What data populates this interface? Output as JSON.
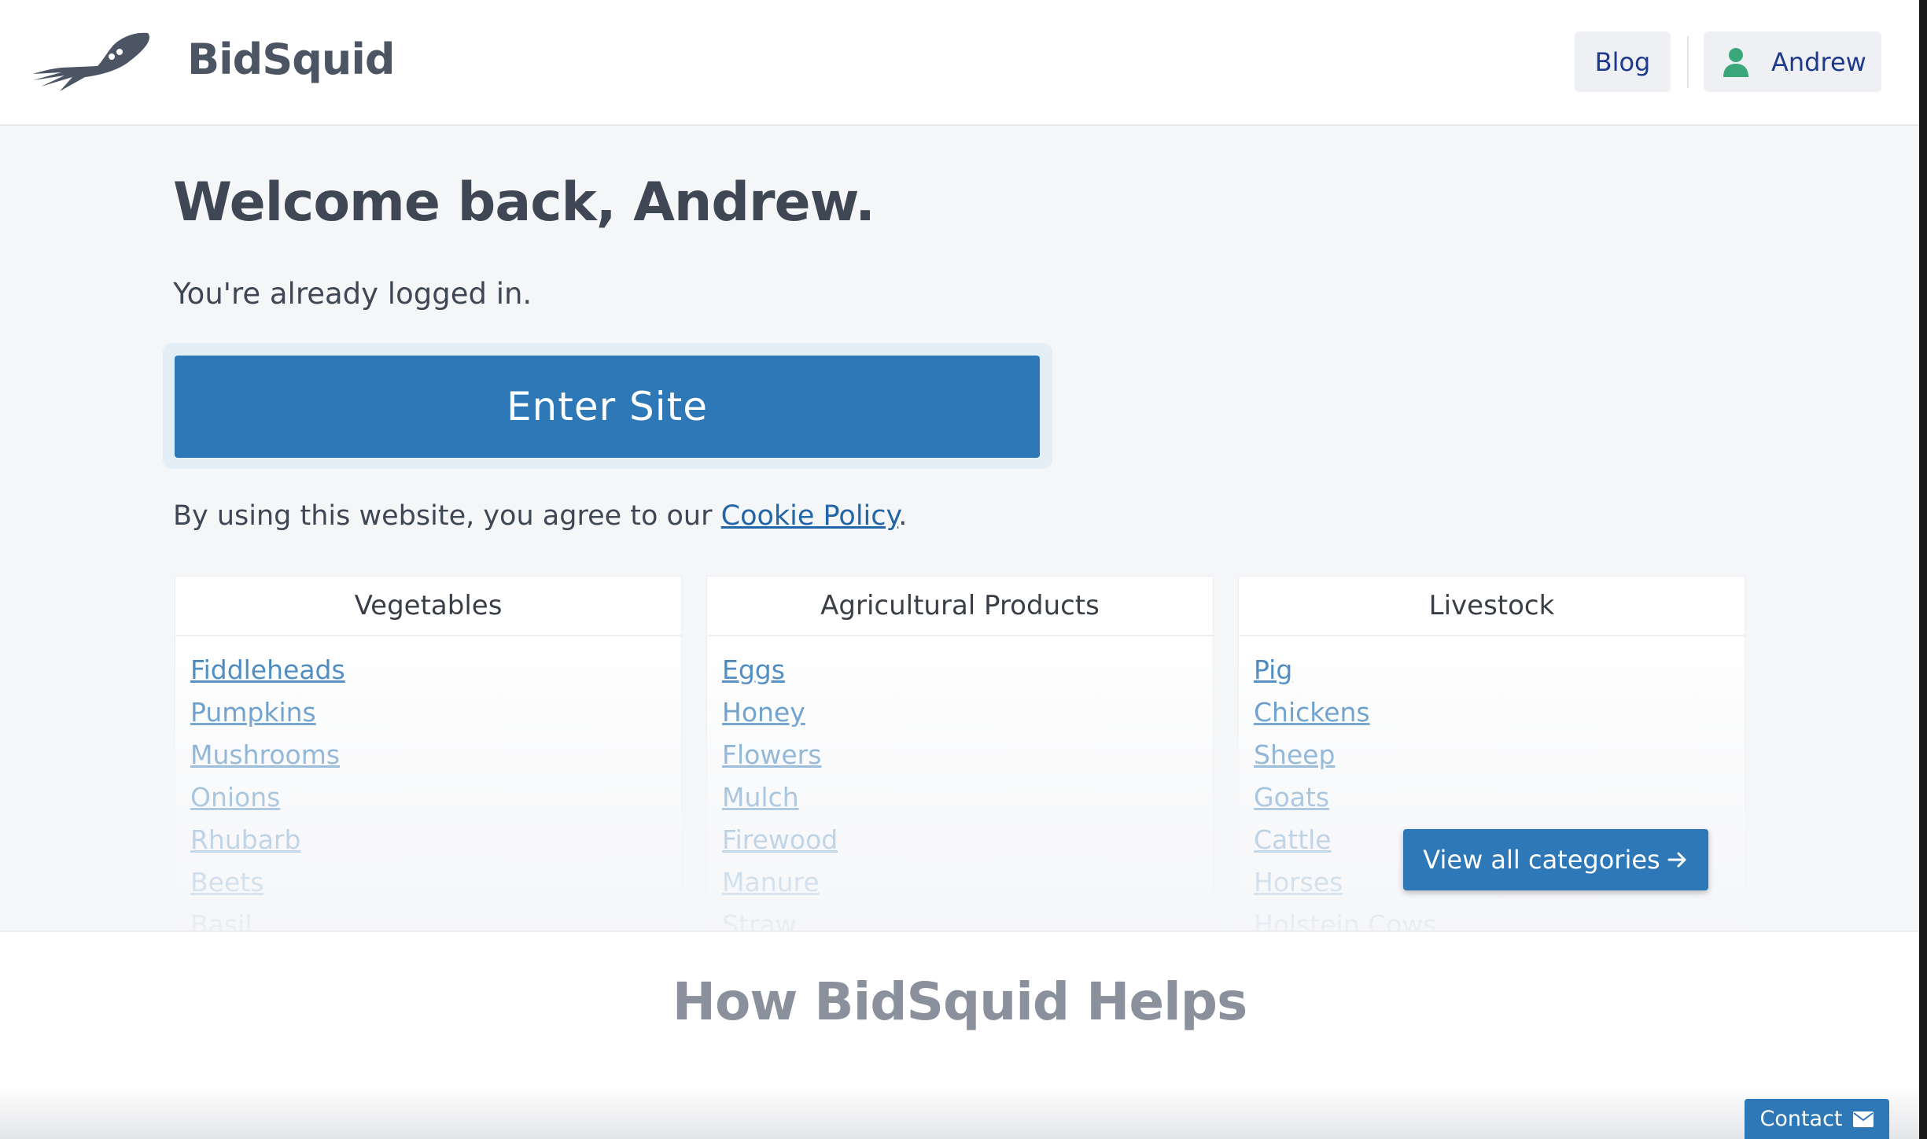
{
  "header": {
    "brand": "BidSquid",
    "nav": {
      "blog": "Blog",
      "user": "Andrew"
    }
  },
  "main": {
    "welcome": "Welcome back, Andrew.",
    "logged_in": "You're already logged in.",
    "enter_button": "Enter Site",
    "agree_text": "By using this website, you agree to our ",
    "cookie_link": "Cookie Policy",
    "agree_end": "."
  },
  "categories": [
    {
      "title": "Vegetables",
      "items": [
        "Fiddleheads",
        "Pumpkins",
        "Mushrooms",
        "Onions",
        "Rhubarb",
        "Beets",
        "Basil"
      ]
    },
    {
      "title": "Agricultural Products",
      "items": [
        "Eggs",
        "Honey",
        "Flowers",
        "Mulch",
        "Firewood",
        "Manure",
        "Straw"
      ]
    },
    {
      "title": "Livestock",
      "items": [
        "Pig",
        "Chickens",
        "Sheep",
        "Goats",
        "Cattle",
        "Horses",
        "Holstein Cows"
      ]
    }
  ],
  "view_all": "View all categories",
  "helps": {
    "title": "How BidSquid Helps"
  },
  "contact": "Contact",
  "colors": {
    "accent": "#2f78b7",
    "user_icon": "#3aa77a",
    "text": "#3f4654"
  },
  "icons": {
    "logo": "squid-logo-icon",
    "user": "user-icon",
    "arrow": "arrow-right-icon",
    "mail": "mail-icon"
  }
}
